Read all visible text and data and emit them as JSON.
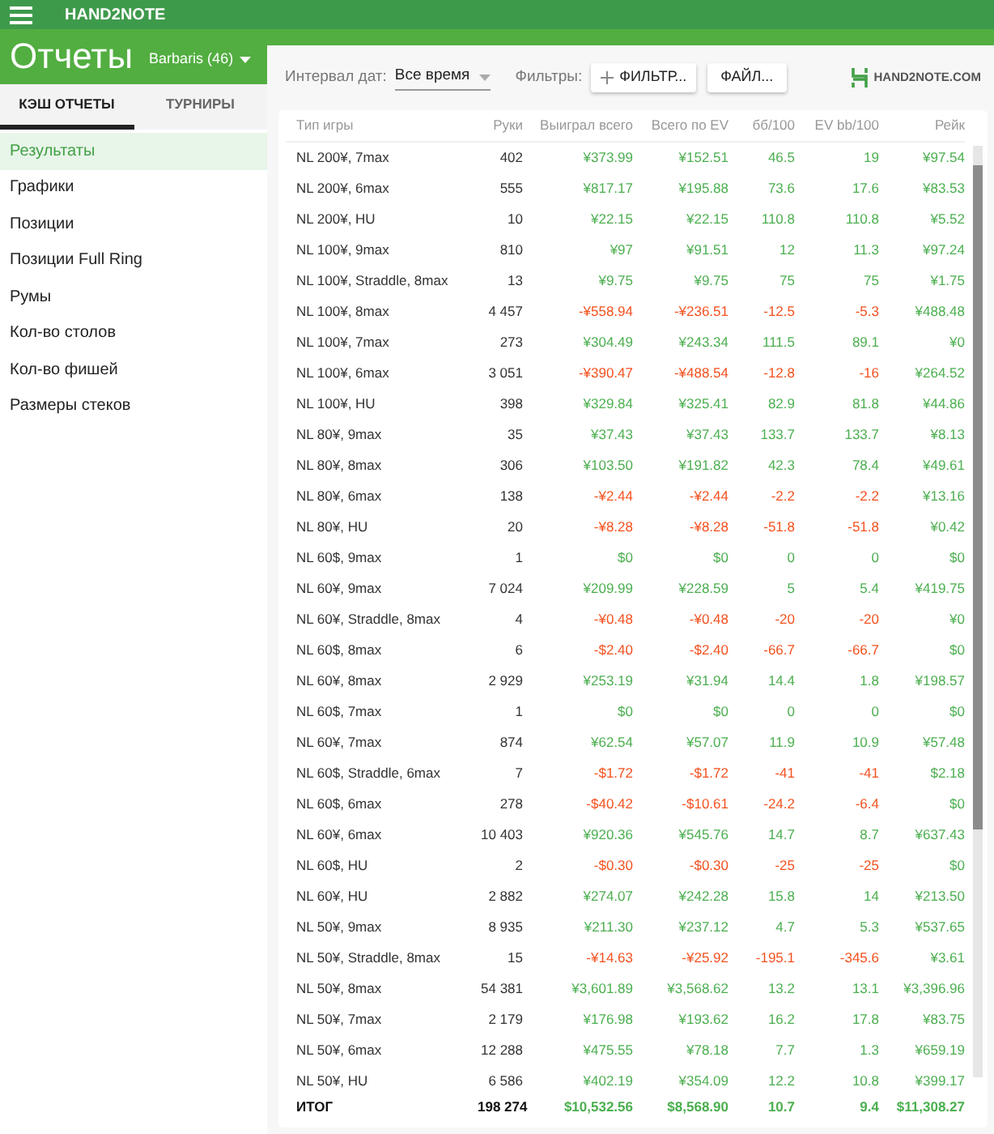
{
  "app_bar": {
    "title": "HAND2NOTE"
  },
  "header": {
    "title": "Отчеты",
    "account": "Barbaris (46)"
  },
  "tabs": [
    {
      "label": "КЭШ ОТЧЕТЫ",
      "selected": true
    },
    {
      "label": "ТУРНИРЫ",
      "selected": false
    }
  ],
  "sidebar": {
    "items": [
      {
        "label": "Результаты",
        "selected": true
      },
      {
        "label": "Графики",
        "selected": false
      },
      {
        "label": "Позиции",
        "selected": false
      },
      {
        "label": "Позиции Full Ring",
        "selected": false
      },
      {
        "label": "Румы",
        "selected": false
      },
      {
        "label": "Кол-во столов",
        "selected": false
      },
      {
        "label": "Кол-во фишей",
        "selected": false
      },
      {
        "label": "Размеры стеков",
        "selected": false
      }
    ]
  },
  "toolbar": {
    "date_label": "Интервал дат:",
    "date_value": "Все время",
    "filters_label": "Фильтры:",
    "filter_button": "ФИЛЬТР...",
    "file_button": "ФАЙЛ...",
    "logo": "HAND2NOTE.COM"
  },
  "table": {
    "columns": [
      "Тип игры",
      "Руки",
      "Выиграл всего",
      "Всего по EV",
      "бб/100",
      "EV bb/100",
      "Рейк"
    ],
    "rows": [
      {
        "cells": [
          "NL 200¥, 7max",
          "402",
          "¥373.99",
          "¥152.51",
          "46.5",
          "19",
          "¥97.54"
        ],
        "negative": false
      },
      {
        "cells": [
          "NL 200¥, 6max",
          "555",
          "¥817.17",
          "¥195.88",
          "73.6",
          "17.6",
          "¥83.53"
        ],
        "negative": false
      },
      {
        "cells": [
          "NL 200¥, HU",
          "10",
          "¥22.15",
          "¥22.15",
          "110.8",
          "110.8",
          "¥5.52"
        ],
        "negative": false
      },
      {
        "cells": [
          "NL 100¥, 9max",
          "810",
          "¥97",
          "¥91.51",
          "12",
          "11.3",
          "¥97.24"
        ],
        "negative": false
      },
      {
        "cells": [
          "NL 100¥, Straddle, 8max",
          "13",
          "¥9.75",
          "¥9.75",
          "75",
          "75",
          "¥1.75"
        ],
        "negative": false
      },
      {
        "cells": [
          "NL 100¥, 8max",
          "4 457",
          "-¥558.94",
          "-¥236.51",
          "-12.5",
          "-5.3",
          "¥488.48"
        ],
        "negative": true
      },
      {
        "cells": [
          "NL 100¥, 7max",
          "273",
          "¥304.49",
          "¥243.34",
          "111.5",
          "89.1",
          "¥0"
        ],
        "negative": false
      },
      {
        "cells": [
          "NL 100¥, 6max",
          "3 051",
          "-¥390.47",
          "-¥488.54",
          "-12.8",
          "-16",
          "¥264.52"
        ],
        "negative": true
      },
      {
        "cells": [
          "NL 100¥, HU",
          "398",
          "¥329.84",
          "¥325.41",
          "82.9",
          "81.8",
          "¥44.86"
        ],
        "negative": false
      },
      {
        "cells": [
          "NL 80¥, 9max",
          "35",
          "¥37.43",
          "¥37.43",
          "133.7",
          "133.7",
          "¥8.13"
        ],
        "negative": false
      },
      {
        "cells": [
          "NL 80¥, 8max",
          "306",
          "¥103.50",
          "¥191.82",
          "42.3",
          "78.4",
          "¥49.61"
        ],
        "negative": false
      },
      {
        "cells": [
          "NL 80¥, 6max",
          "138",
          "-¥2.44",
          "-¥2.44",
          "-2.2",
          "-2.2",
          "¥13.16"
        ],
        "negative": true
      },
      {
        "cells": [
          "NL 80¥, HU",
          "20",
          "-¥8.28",
          "-¥8.28",
          "-51.8",
          "-51.8",
          "¥0.42"
        ],
        "negative": true
      },
      {
        "cells": [
          "NL 60$, 9max",
          "1",
          "$0",
          "$0",
          "0",
          "0",
          "$0"
        ],
        "negative": false
      },
      {
        "cells": [
          "NL 60¥, 9max",
          "7 024",
          "¥209.99",
          "¥228.59",
          "5",
          "5.4",
          "¥419.75"
        ],
        "negative": false
      },
      {
        "cells": [
          "NL 60¥, Straddle, 8max",
          "4",
          "-¥0.48",
          "-¥0.48",
          "-20",
          "-20",
          "¥0"
        ],
        "negative": true
      },
      {
        "cells": [
          "NL 60$, 8max",
          "6",
          "-$2.40",
          "-$2.40",
          "-66.7",
          "-66.7",
          "$0"
        ],
        "negative": true
      },
      {
        "cells": [
          "NL 60¥, 8max",
          "2 929",
          "¥253.19",
          "¥31.94",
          "14.4",
          "1.8",
          "¥198.57"
        ],
        "negative": false
      },
      {
        "cells": [
          "NL 60$, 7max",
          "1",
          "$0",
          "$0",
          "0",
          "0",
          "$0"
        ],
        "negative": false
      },
      {
        "cells": [
          "NL 60¥, 7max",
          "874",
          "¥62.54",
          "¥57.07",
          "11.9",
          "10.9",
          "¥57.48"
        ],
        "negative": false
      },
      {
        "cells": [
          "NL 60$, Straddle, 6max",
          "7",
          "-$1.72",
          "-$1.72",
          "-41",
          "-41",
          "$2.18"
        ],
        "negative": true
      },
      {
        "cells": [
          "NL 60$, 6max",
          "278",
          "-$40.42",
          "-$10.61",
          "-24.2",
          "-6.4",
          "$0"
        ],
        "negative": true
      },
      {
        "cells": [
          "NL 60¥, 6max",
          "10 403",
          "¥920.36",
          "¥545.76",
          "14.7",
          "8.7",
          "¥637.43"
        ],
        "negative": false
      },
      {
        "cells": [
          "NL 60$, HU",
          "2",
          "-$0.30",
          "-$0.30",
          "-25",
          "-25",
          "$0"
        ],
        "negative": true
      },
      {
        "cells": [
          "NL 60¥, HU",
          "2 882",
          "¥274.07",
          "¥242.28",
          "15.8",
          "14",
          "¥213.50"
        ],
        "negative": false
      },
      {
        "cells": [
          "NL 50¥, 9max",
          "8 935",
          "¥211.30",
          "¥237.12",
          "4.7",
          "5.3",
          "¥537.65"
        ],
        "negative": false
      },
      {
        "cells": [
          "NL 50¥, Straddle, 8max",
          "15",
          "-¥14.63",
          "-¥25.92",
          "-195.1",
          "-345.6",
          "¥3.61"
        ],
        "negative": true
      },
      {
        "cells": [
          "NL 50¥, 8max",
          "54 381",
          "¥3,601.89",
          "¥3,568.62",
          "13.2",
          "13.1",
          "¥3,396.96"
        ],
        "negative": false
      },
      {
        "cells": [
          "NL 50¥, 7max",
          "2 179",
          "¥176.98",
          "¥193.62",
          "16.2",
          "17.8",
          "¥83.75"
        ],
        "negative": false
      },
      {
        "cells": [
          "NL 50¥, 6max",
          "12 288",
          "¥475.55",
          "¥78.18",
          "7.7",
          "1.3",
          "¥659.19"
        ],
        "negative": false
      },
      {
        "cells": [
          "NL 50¥, HU",
          "6 586",
          "¥402.19",
          "¥354.09",
          "12.2",
          "10.8",
          "¥399.17"
        ],
        "negative": false
      }
    ],
    "total": [
      "ИТОГ",
      "198 274",
      "$10,532.56",
      "$8,568.90",
      "10.7",
      "9.4",
      "$11,308.27"
    ]
  }
}
